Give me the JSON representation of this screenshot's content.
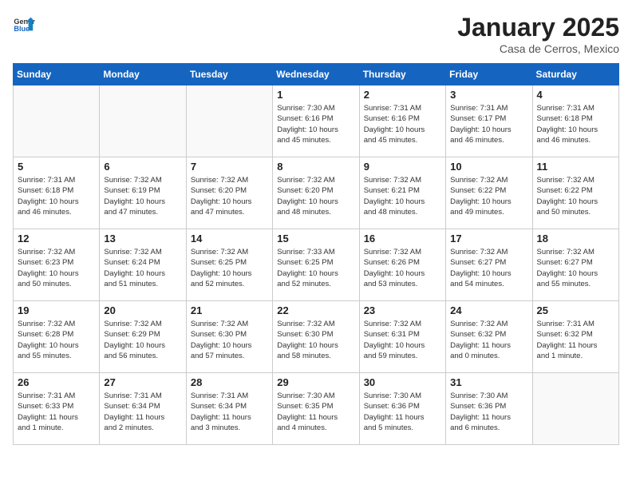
{
  "header": {
    "logo_general": "General",
    "logo_blue": "Blue",
    "title": "January 2025",
    "subtitle": "Casa de Cerros, Mexico"
  },
  "weekdays": [
    "Sunday",
    "Monday",
    "Tuesday",
    "Wednesday",
    "Thursday",
    "Friday",
    "Saturday"
  ],
  "weeks": [
    [
      {
        "day": "",
        "info": ""
      },
      {
        "day": "",
        "info": ""
      },
      {
        "day": "",
        "info": ""
      },
      {
        "day": "1",
        "info": "Sunrise: 7:30 AM\nSunset: 6:16 PM\nDaylight: 10 hours\nand 45 minutes."
      },
      {
        "day": "2",
        "info": "Sunrise: 7:31 AM\nSunset: 6:16 PM\nDaylight: 10 hours\nand 45 minutes."
      },
      {
        "day": "3",
        "info": "Sunrise: 7:31 AM\nSunset: 6:17 PM\nDaylight: 10 hours\nand 46 minutes."
      },
      {
        "day": "4",
        "info": "Sunrise: 7:31 AM\nSunset: 6:18 PM\nDaylight: 10 hours\nand 46 minutes."
      }
    ],
    [
      {
        "day": "5",
        "info": "Sunrise: 7:31 AM\nSunset: 6:18 PM\nDaylight: 10 hours\nand 46 minutes."
      },
      {
        "day": "6",
        "info": "Sunrise: 7:32 AM\nSunset: 6:19 PM\nDaylight: 10 hours\nand 47 minutes."
      },
      {
        "day": "7",
        "info": "Sunrise: 7:32 AM\nSunset: 6:20 PM\nDaylight: 10 hours\nand 47 minutes."
      },
      {
        "day": "8",
        "info": "Sunrise: 7:32 AM\nSunset: 6:20 PM\nDaylight: 10 hours\nand 48 minutes."
      },
      {
        "day": "9",
        "info": "Sunrise: 7:32 AM\nSunset: 6:21 PM\nDaylight: 10 hours\nand 48 minutes."
      },
      {
        "day": "10",
        "info": "Sunrise: 7:32 AM\nSunset: 6:22 PM\nDaylight: 10 hours\nand 49 minutes."
      },
      {
        "day": "11",
        "info": "Sunrise: 7:32 AM\nSunset: 6:22 PM\nDaylight: 10 hours\nand 50 minutes."
      }
    ],
    [
      {
        "day": "12",
        "info": "Sunrise: 7:32 AM\nSunset: 6:23 PM\nDaylight: 10 hours\nand 50 minutes."
      },
      {
        "day": "13",
        "info": "Sunrise: 7:32 AM\nSunset: 6:24 PM\nDaylight: 10 hours\nand 51 minutes."
      },
      {
        "day": "14",
        "info": "Sunrise: 7:32 AM\nSunset: 6:25 PM\nDaylight: 10 hours\nand 52 minutes."
      },
      {
        "day": "15",
        "info": "Sunrise: 7:33 AM\nSunset: 6:25 PM\nDaylight: 10 hours\nand 52 minutes."
      },
      {
        "day": "16",
        "info": "Sunrise: 7:32 AM\nSunset: 6:26 PM\nDaylight: 10 hours\nand 53 minutes."
      },
      {
        "day": "17",
        "info": "Sunrise: 7:32 AM\nSunset: 6:27 PM\nDaylight: 10 hours\nand 54 minutes."
      },
      {
        "day": "18",
        "info": "Sunrise: 7:32 AM\nSunset: 6:27 PM\nDaylight: 10 hours\nand 55 minutes."
      }
    ],
    [
      {
        "day": "19",
        "info": "Sunrise: 7:32 AM\nSunset: 6:28 PM\nDaylight: 10 hours\nand 55 minutes."
      },
      {
        "day": "20",
        "info": "Sunrise: 7:32 AM\nSunset: 6:29 PM\nDaylight: 10 hours\nand 56 minutes."
      },
      {
        "day": "21",
        "info": "Sunrise: 7:32 AM\nSunset: 6:30 PM\nDaylight: 10 hours\nand 57 minutes."
      },
      {
        "day": "22",
        "info": "Sunrise: 7:32 AM\nSunset: 6:30 PM\nDaylight: 10 hours\nand 58 minutes."
      },
      {
        "day": "23",
        "info": "Sunrise: 7:32 AM\nSunset: 6:31 PM\nDaylight: 10 hours\nand 59 minutes."
      },
      {
        "day": "24",
        "info": "Sunrise: 7:32 AM\nSunset: 6:32 PM\nDaylight: 11 hours\nand 0 minutes."
      },
      {
        "day": "25",
        "info": "Sunrise: 7:31 AM\nSunset: 6:32 PM\nDaylight: 11 hours\nand 1 minute."
      }
    ],
    [
      {
        "day": "26",
        "info": "Sunrise: 7:31 AM\nSunset: 6:33 PM\nDaylight: 11 hours\nand 1 minute."
      },
      {
        "day": "27",
        "info": "Sunrise: 7:31 AM\nSunset: 6:34 PM\nDaylight: 11 hours\nand 2 minutes."
      },
      {
        "day": "28",
        "info": "Sunrise: 7:31 AM\nSunset: 6:34 PM\nDaylight: 11 hours\nand 3 minutes."
      },
      {
        "day": "29",
        "info": "Sunrise: 7:30 AM\nSunset: 6:35 PM\nDaylight: 11 hours\nand 4 minutes."
      },
      {
        "day": "30",
        "info": "Sunrise: 7:30 AM\nSunset: 6:36 PM\nDaylight: 11 hours\nand 5 minutes."
      },
      {
        "day": "31",
        "info": "Sunrise: 7:30 AM\nSunset: 6:36 PM\nDaylight: 11 hours\nand 6 minutes."
      },
      {
        "day": "",
        "info": ""
      }
    ]
  ]
}
